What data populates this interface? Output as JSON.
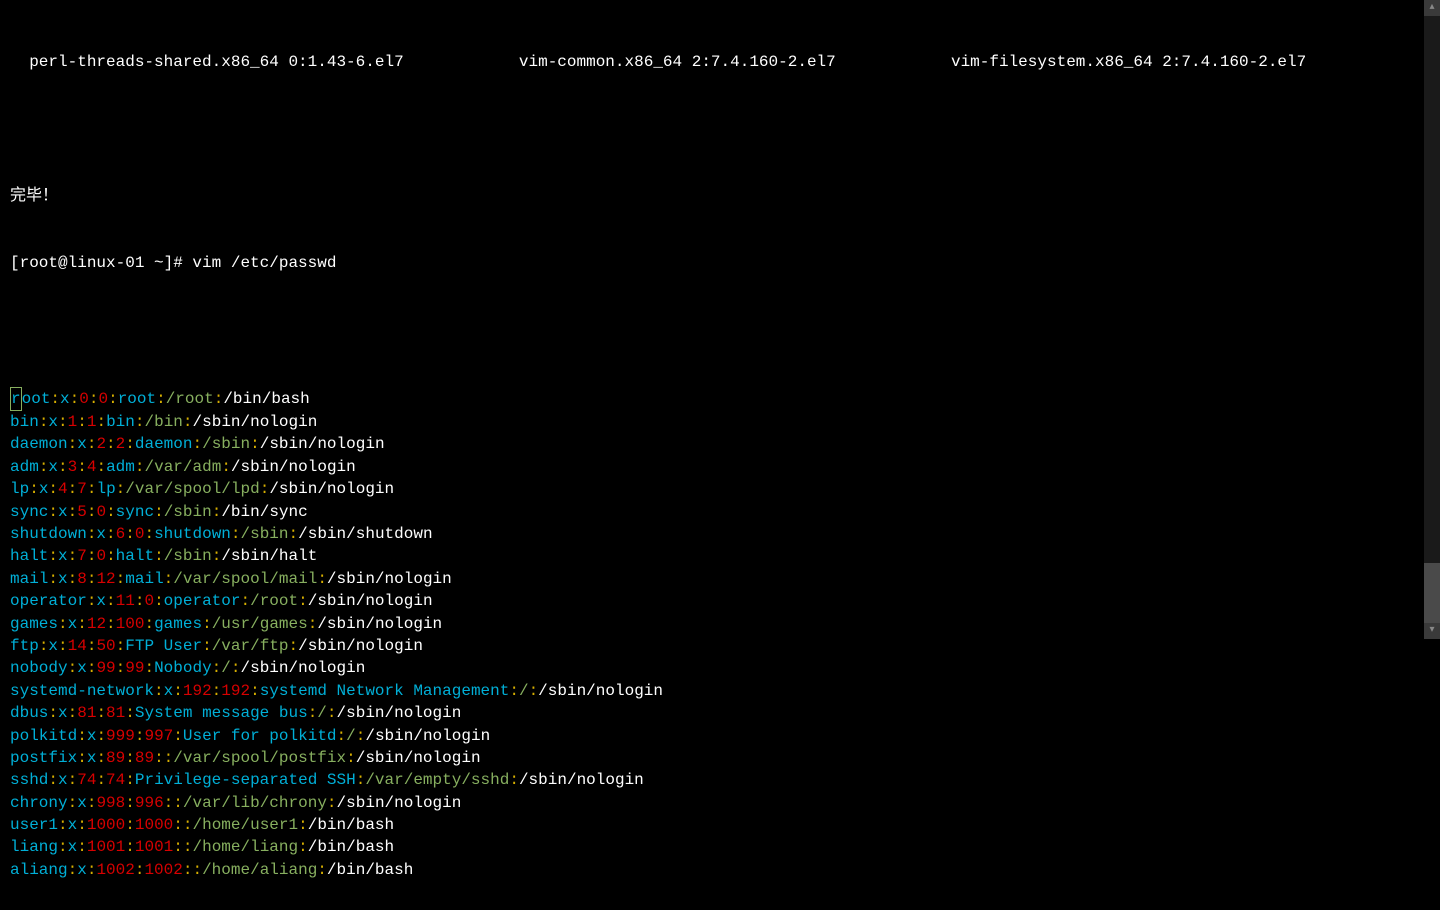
{
  "header_packages": [
    "  perl-threads-shared.x86_64 0:1.43-6.el7          ",
    "  vim-common.x86_64 2:7.4.160-2.el7          ",
    "  vim-filesystem.x86_64 2:7.4.160-2.el7"
  ],
  "done_text": "完毕！",
  "prompt_full": "[root@linux-01 ~]# vim /etc/passwd",
  "entries": [
    {
      "user": "root",
      "x": "x",
      "uid": "0",
      "gid": "0",
      "desc": "root",
      "home": "/root",
      "shell": "/bin/bash"
    },
    {
      "user": "bin",
      "x": "x",
      "uid": "1",
      "gid": "1",
      "desc": "bin",
      "home": "/bin",
      "shell": "/sbin/nologin"
    },
    {
      "user": "daemon",
      "x": "x",
      "uid": "2",
      "gid": "2",
      "desc": "daemon",
      "home": "/sbin",
      "shell": "/sbin/nologin"
    },
    {
      "user": "adm",
      "x": "x",
      "uid": "3",
      "gid": "4",
      "desc": "adm",
      "home": "/var/adm",
      "shell": "/sbin/nologin"
    },
    {
      "user": "lp",
      "x": "x",
      "uid": "4",
      "gid": "7",
      "desc": "lp",
      "home": "/var/spool/lpd",
      "shell": "/sbin/nologin"
    },
    {
      "user": "sync",
      "x": "x",
      "uid": "5",
      "gid": "0",
      "desc": "sync",
      "home": "/sbin",
      "shell": "/bin/sync"
    },
    {
      "user": "shutdown",
      "x": "x",
      "uid": "6",
      "gid": "0",
      "desc": "shutdown",
      "home": "/sbin",
      "shell": "/sbin/shutdown"
    },
    {
      "user": "halt",
      "x": "x",
      "uid": "7",
      "gid": "0",
      "desc": "halt",
      "home": "/sbin",
      "shell": "/sbin/halt"
    },
    {
      "user": "mail",
      "x": "x",
      "uid": "8",
      "gid": "12",
      "desc": "mail",
      "home": "/var/spool/mail",
      "shell": "/sbin/nologin"
    },
    {
      "user": "operator",
      "x": "x",
      "uid": "11",
      "gid": "0",
      "desc": "operator",
      "home": "/root",
      "shell": "/sbin/nologin"
    },
    {
      "user": "games",
      "x": "x",
      "uid": "12",
      "gid": "100",
      "desc": "games",
      "home": "/usr/games",
      "shell": "/sbin/nologin"
    },
    {
      "user": "ftp",
      "x": "x",
      "uid": "14",
      "gid": "50",
      "desc": "FTP User",
      "home": "/var/ftp",
      "shell": "/sbin/nologin"
    },
    {
      "user": "nobody",
      "x": "x",
      "uid": "99",
      "gid": "99",
      "desc": "Nobody",
      "home": "/",
      "shell": "/sbin/nologin"
    },
    {
      "user": "systemd-network",
      "x": "x",
      "uid": "192",
      "gid": "192",
      "desc": "systemd Network Management",
      "home": "/",
      "shell": "/sbin/nologin"
    },
    {
      "user": "dbus",
      "x": "x",
      "uid": "81",
      "gid": "81",
      "desc": "System message bus",
      "home": "/",
      "shell": "/sbin/nologin"
    },
    {
      "user": "polkitd",
      "x": "x",
      "uid": "999",
      "gid": "997",
      "desc": "User for polkitd",
      "home": "/",
      "shell": "/sbin/nologin"
    },
    {
      "user": "postfix",
      "x": "x",
      "uid": "89",
      "gid": "89",
      "desc": "",
      "home": "/var/spool/postfix",
      "shell": "/sbin/nologin"
    },
    {
      "user": "sshd",
      "x": "x",
      "uid": "74",
      "gid": "74",
      "desc": "Privilege-separated SSH",
      "home": "/var/empty/sshd",
      "shell": "/sbin/nologin"
    },
    {
      "user": "chrony",
      "x": "x",
      "uid": "998",
      "gid": "996",
      "desc": "",
      "home": "/var/lib/chrony",
      "shell": "/sbin/nologin"
    },
    {
      "user": "user1",
      "x": "x",
      "uid": "1000",
      "gid": "1000",
      "desc": "",
      "home": "/home/user1",
      "shell": "/bin/bash"
    },
    {
      "user": "liang",
      "x": "x",
      "uid": "1001",
      "gid": "1001",
      "desc": "",
      "home": "/home/liang",
      "shell": "/bin/bash"
    },
    {
      "user": "aliang",
      "x": "x",
      "uid": "1002",
      "gid": "1002",
      "desc": "",
      "home": "/home/aliang",
      "shell": "/bin/bash"
    }
  ],
  "colon": ":",
  "scroll_up_glyph": "▴",
  "scroll_down_glyph": "▾"
}
